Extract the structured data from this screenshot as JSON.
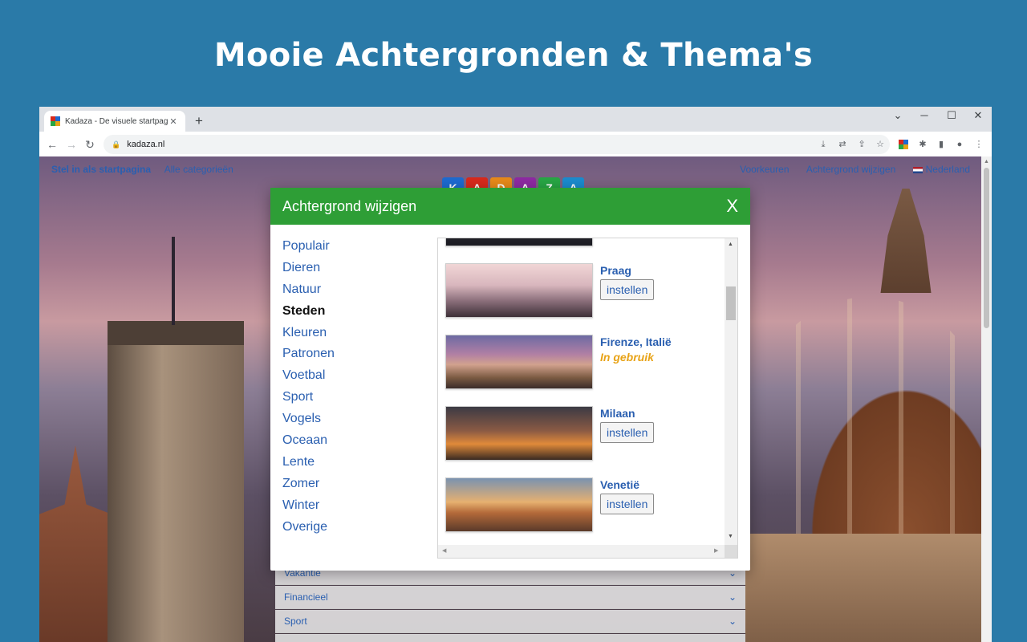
{
  "hero": {
    "title": "Mooie Achtergronden & Thema's"
  },
  "browser": {
    "tab_title": "Kadaza - De visuele startpagina",
    "tab_close": "✕",
    "new_tab": "+",
    "window_controls": {
      "collapse": "⌄",
      "minimize": "─",
      "maximize": "☐",
      "close": "✕"
    },
    "nav": {
      "back": "←",
      "forward": "→",
      "reload": "↻"
    },
    "url": "kadaza.nl",
    "lock": "🔒",
    "icons": {
      "install": "⤓",
      "translate": "⇄",
      "share": "⇪",
      "bookmark": "☆",
      "extensions": "✱",
      "sidebar": "▮",
      "profile": "●",
      "menu": "⋮"
    }
  },
  "page": {
    "left_links": [
      "Stel in als startpagina",
      "Alle categorieën"
    ],
    "right_links": [
      "Voorkeuren",
      "Achtergrond wijzigen",
      "Nederland"
    ],
    "logo_letters": [
      "K",
      "A",
      "D",
      "A",
      "Z",
      "A"
    ],
    "logo_colors": [
      "#1d6bd1",
      "#d92a1c",
      "#e88a1a",
      "#8e2aa3",
      "#28a745",
      "#1b8ccf"
    ],
    "accordion": [
      "Vakantie",
      "Financieel",
      "Sport"
    ],
    "chevron": "⌄"
  },
  "modal": {
    "title": "Achtergrond wijzigen",
    "close": "X",
    "categories": [
      "Populair",
      "Dieren",
      "Natuur",
      "Steden",
      "Kleuren",
      "Patronen",
      "Voetbal",
      "Sport",
      "Vogels",
      "Oceaan",
      "Lente",
      "Zomer",
      "Winter",
      "Overige"
    ],
    "active_category": "Steden",
    "set_label": "instellen",
    "items": [
      {
        "name": "",
        "status": "set"
      },
      {
        "name": "Praag",
        "status": "set"
      },
      {
        "name": "Firenze, Italië",
        "status": "in_use",
        "in_use_label": "In gebruik"
      },
      {
        "name": "Milaan",
        "status": "set"
      },
      {
        "name": "Venetië",
        "status": "set"
      }
    ],
    "scroll": {
      "up": "▲",
      "down": "▼",
      "left": "◀",
      "right": "▶"
    }
  }
}
